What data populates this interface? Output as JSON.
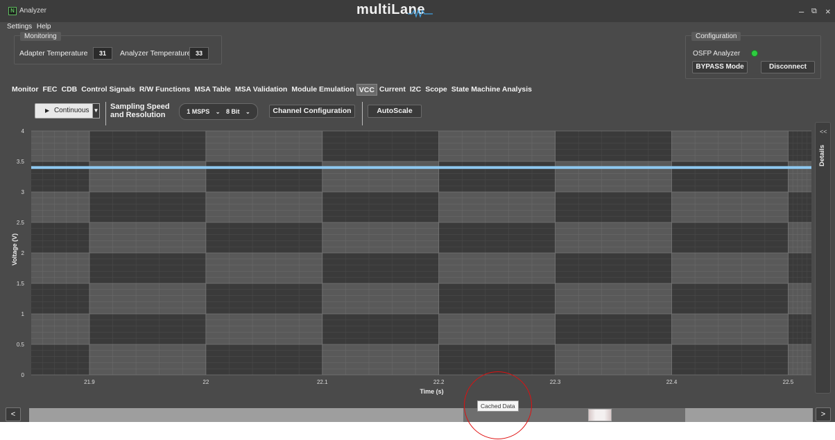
{
  "window": {
    "app_title": "Analyzer",
    "brand": "multiLane",
    "minimize": "–",
    "restore": "⧉",
    "close": "×"
  },
  "menu": [
    "Settings",
    "Help"
  ],
  "monitoring": {
    "title": "Monitoring",
    "adapter_label": "Adapter Temperature",
    "adapter_value": "31",
    "analyzer_label": "Analyzer Temperature",
    "analyzer_value": "33"
  },
  "configuration": {
    "title": "Configuration",
    "device_label": "OSFP Analyzer",
    "status_color": "#2ecc40",
    "bypass_label": "BYPASS Mode",
    "disconnect_label": "Disconnect"
  },
  "tabs": [
    "Monitor",
    "FEC",
    "CDB",
    "Control Signals",
    "R/W Functions",
    "MSA Table",
    "MSA Validation",
    "Module Emulation",
    "VCC",
    "Current",
    "I2C",
    "Scope",
    "State Machine Analysis"
  ],
  "active_tab": "VCC",
  "toolbar": {
    "run_label": "Continuous",
    "sampling_label_1": "Sampling Speed",
    "sampling_label_2": "and Resolution",
    "speed_value": "1 MSPS",
    "resolution_value": "8 Bit",
    "channel_config_label": "Channel Configuration",
    "autoscale_label": "AutoScale"
  },
  "details_label": "Details",
  "details_chevron": "<<",
  "scroll": {
    "left": "<",
    "right": ">",
    "tooltip": "Cached Data"
  },
  "chart_data": {
    "type": "line",
    "title": "",
    "xlabel": "Time (s)",
    "ylabel": "Voltage (V)",
    "xlim": [
      21.85,
      22.52
    ],
    "ylim": [
      0,
      4
    ],
    "x_ticks": [
      21.9,
      22,
      22.1,
      22.2,
      22.3,
      22.4,
      22.5
    ],
    "x_tick_labels": [
      "21.9",
      "22",
      "22.1",
      "22.2",
      "22.3",
      "22.4",
      "22.5"
    ],
    "y_ticks": [
      0,
      0.5,
      1,
      1.5,
      2,
      2.5,
      3,
      3.5,
      4
    ],
    "y_tick_labels": [
      "0",
      "0.5",
      "1",
      "1.5",
      "2",
      "2.5",
      "3",
      "3.5",
      "4"
    ],
    "grid": true,
    "series": [
      {
        "color": "#8ec8f0",
        "x": [
          21.85,
          22.52
        ],
        "y": [
          3.4,
          3.4
        ]
      }
    ]
  }
}
